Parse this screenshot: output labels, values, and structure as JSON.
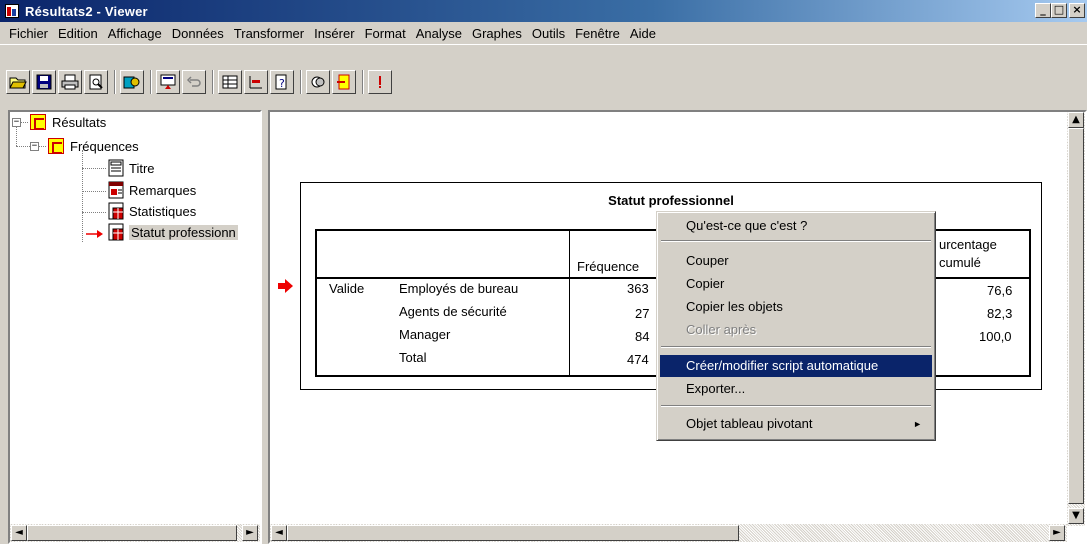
{
  "window": {
    "title": "Résultats2 - Viewer"
  },
  "menu": [
    "Fichier",
    "Edition",
    "Affichage",
    "Données",
    "Transformer",
    "Insérer",
    "Format",
    "Analyse",
    "Graphes",
    "Outils",
    "Fenêtre",
    "Aide"
  ],
  "outline": {
    "root": "Résultats",
    "group": "Fréquences",
    "items": [
      "Titre",
      "Remarques",
      "Statistiques",
      "Statut professionn"
    ]
  },
  "pivot": {
    "title": "Statut professionnel",
    "col_freq": "Fréquence",
    "col_cum_1": "urcentage",
    "col_cum_2": "cumulé",
    "row_group": "Valide",
    "rows": [
      {
        "label": "Employés de bureau",
        "freq": "363",
        "cum": "76,6"
      },
      {
        "label": "Agents de sécurité",
        "freq": "27",
        "cum": "82,3"
      },
      {
        "label": "Manager",
        "freq": "84",
        "cum": "100,0"
      },
      {
        "label": "Total",
        "freq": "474",
        "cum": ""
      }
    ]
  },
  "context_menu": {
    "whats_this": "Qu'est-ce que c'est ?",
    "cut": "Couper",
    "copy": "Copier",
    "copy_objects": "Copier les objets",
    "paste_after": "Coller après",
    "create_script": "Créer/modifier script automatique",
    "export": "Exporter...",
    "pivot_object": "Objet tableau pivotant"
  }
}
